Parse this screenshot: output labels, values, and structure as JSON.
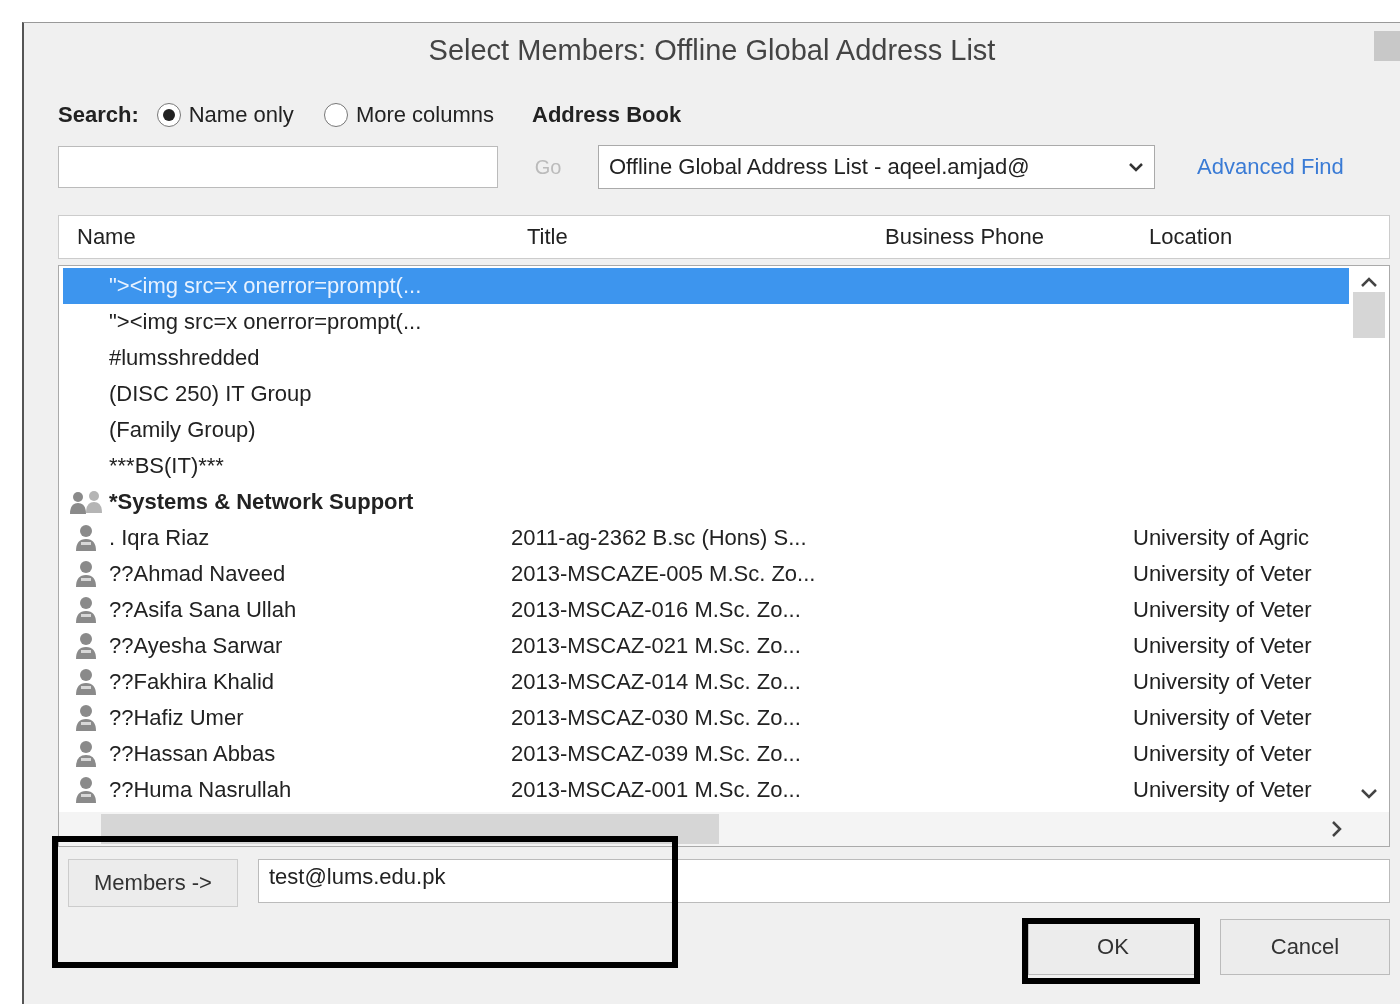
{
  "window": {
    "title": "Select Members: Offline Global Address List"
  },
  "search": {
    "label": "Search:",
    "options": [
      {
        "label": "Name only",
        "selected": true
      },
      {
        "label": "More columns",
        "selected": false
      }
    ],
    "go_button": {
      "label": "Go",
      "disabled": true
    },
    "address_book_label": "Address Book",
    "address_book": "Offline Global Address List - aqeel.amjad@",
    "advanced_find": "Advanced Find"
  },
  "table": {
    "columns": [
      "Name",
      "Title",
      "Business Phone",
      "Location"
    ],
    "rows": [
      {
        "kind": "plain",
        "name": "\"><img src=x onerror=prompt(...",
        "selected": true
      },
      {
        "kind": "plain",
        "name": "\"><img src=x onerror=prompt(...",
        "selected": false
      },
      {
        "kind": "plain",
        "name": "#lumsshredded",
        "selected": false
      },
      {
        "kind": "plain",
        "name": "(DISC 250) IT Group",
        "selected": false
      },
      {
        "kind": "plain",
        "name": "(Family Group)",
        "selected": false
      },
      {
        "kind": "plain",
        "name": "***BS(IT)***",
        "selected": false
      },
      {
        "kind": "group",
        "name": "*Systems & Network Support",
        "selected": false
      },
      {
        "kind": "person",
        "name": ". Iqra Riaz",
        "title": "2011-ag-2362 B.sc (Hons) S...",
        "location": "University of Agric",
        "selected": false
      },
      {
        "kind": "person",
        "name": "??Ahmad Naveed",
        "title": "2013-MSCAZE-005 M.Sc. Zo...",
        "location": "University of Veter",
        "selected": false
      },
      {
        "kind": "person",
        "name": "??Asifa Sana Ullah",
        "title": "2013-MSCAZ-016 M.Sc. Zo...",
        "location": "University of Veter",
        "selected": false
      },
      {
        "kind": "person",
        "name": "??Ayesha Sarwar",
        "title": "2013-MSCAZ-021 M.Sc. Zo...",
        "location": "University of Veter",
        "selected": false
      },
      {
        "kind": "person",
        "name": "??Fakhira Khalid",
        "title": "2013-MSCAZ-014 M.Sc. Zo...",
        "location": "University of Veter",
        "selected": false
      },
      {
        "kind": "person",
        "name": "??Hafiz Umer",
        "title": "2013-MSCAZ-030 M.Sc. Zo...",
        "location": "University of Veter",
        "selected": false
      },
      {
        "kind": "person",
        "name": "??Hassan Abbas",
        "title": "2013-MSCAZ-039 M.Sc. Zo...",
        "location": "University of Veter",
        "selected": false
      },
      {
        "kind": "person",
        "name": "??Huma Nasrullah",
        "title": "2013-MSCAZ-001 M.Sc. Zo...",
        "location": "University of Veter",
        "selected": false
      }
    ]
  },
  "members": {
    "button": "Members ->",
    "value": "test@lums.edu.pk"
  },
  "buttons": [
    "OK",
    "Cancel"
  ]
}
